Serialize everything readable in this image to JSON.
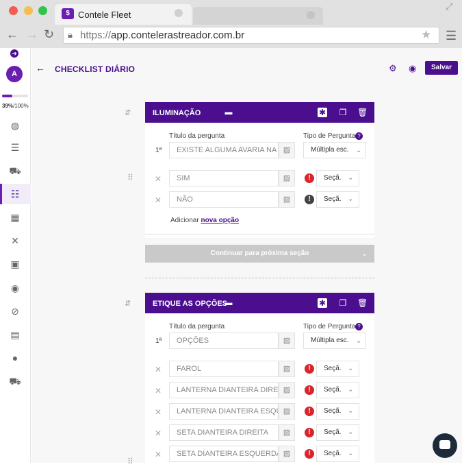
{
  "browser": {
    "tab_title": "Contele Fleet",
    "url_protocol": "https://",
    "url_host": "app.contelerastreador.com.br"
  },
  "sidebar": {
    "avatar_initial": "A",
    "progress_label_pct": "39%",
    "progress_label_total": "/100%",
    "progress": 0.39,
    "items": [
      {
        "icon": "globe-icon"
      },
      {
        "icon": "list-icon"
      },
      {
        "icon": "car-icon"
      },
      {
        "icon": "checklist-icon",
        "active": true
      },
      {
        "icon": "grid-icon"
      },
      {
        "icon": "tools-icon"
      },
      {
        "icon": "fuel-icon"
      },
      {
        "icon": "tire-icon"
      },
      {
        "icon": "block-icon"
      },
      {
        "icon": "id-card-icon"
      },
      {
        "icon": "user-icon"
      },
      {
        "icon": "car-icon"
      }
    ]
  },
  "header": {
    "title": "CHECKLIST DIÁRIO",
    "save_label": "Salvar"
  },
  "sections": [
    {
      "title": "ILUMINAÇÃO",
      "question_label": "Título da pergunta",
      "type_label": "Tipo de Pergunta",
      "number": "1ª",
      "question_value": "EXISTE ALGUMA AVARIA NA",
      "type_value": "Múltipla esc.",
      "options": [
        {
          "text": "SIM",
          "section": "Seçã."
        },
        {
          "text": "NÃO",
          "section": "Seçã."
        }
      ],
      "add_prefix": "Adicionar",
      "add_link": "nova opção",
      "continue_label": "Continuar para próxima seção"
    },
    {
      "title": "ETIQUE AS OPÇÕES",
      "question_label": "Título da pergunta",
      "type_label": "Tipo de Pergunta",
      "number": "1ª",
      "question_value": "OPÇÕES",
      "type_value": "Múltipla esc.",
      "options": [
        {
          "text": "FAROL",
          "section": "Seçã."
        },
        {
          "text": "LANTERNA DIANTEIRA DIRE",
          "section": "Seçã."
        },
        {
          "text": "LANTERNA DIANTEIRA ESQU",
          "section": "Seçã."
        },
        {
          "text": "SETA DIANTEIRA DIREITA",
          "section": "Seçã."
        },
        {
          "text": "SETA DIANTEIRA ESQUERDA",
          "section": "Seçã."
        }
      ]
    }
  ]
}
